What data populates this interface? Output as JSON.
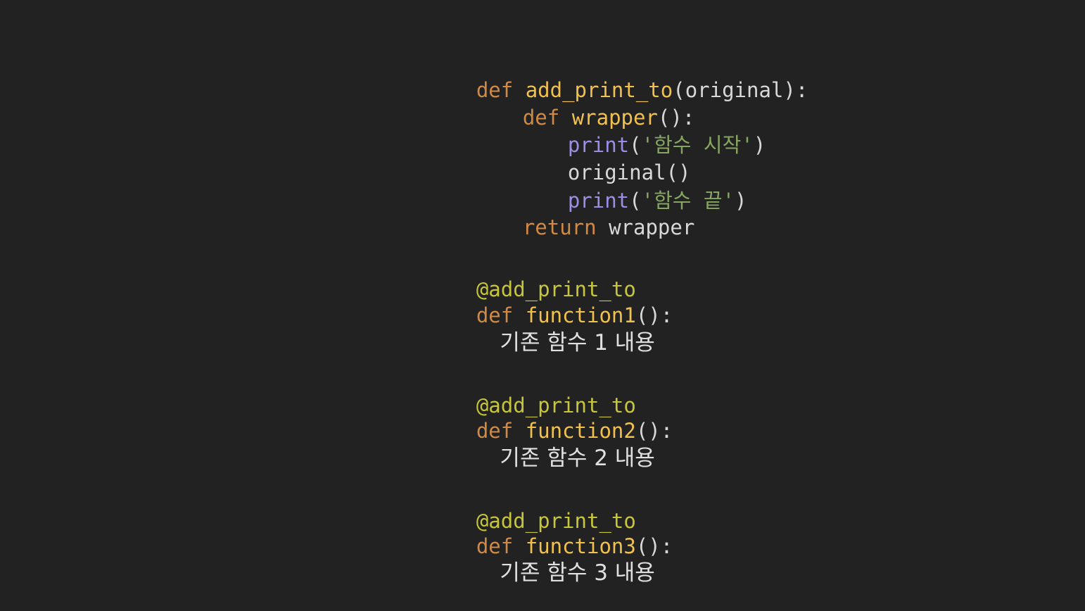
{
  "code": {
    "decorator_def": {
      "kw_def": "def",
      "name": "add_print_to",
      "open_paren": "(",
      "param": "original",
      "close": "):"
    },
    "wrapper_def": {
      "kw_def": "def",
      "name": "wrapper",
      "parens": "():"
    },
    "print_start": {
      "fn": "print",
      "open": "(",
      "str": "'함수 시작'",
      "close": ")"
    },
    "original_call": "original()",
    "print_end": {
      "fn": "print",
      "open": "(",
      "str": "'함수 끝'",
      "close": ")"
    },
    "return_line": {
      "kw_return": "return",
      "value": " wrapper"
    },
    "blocks": [
      {
        "decorator": "@add_print_to",
        "kw_def": "def",
        "name": "function1",
        "parens": "():",
        "body": "기존 함수 1 내용"
      },
      {
        "decorator": "@add_print_to",
        "kw_def": "def",
        "name": "function2",
        "parens": "():",
        "body": "기존 함수 2 내용"
      },
      {
        "decorator": "@add_print_to",
        "kw_def": "def",
        "name": "function3",
        "parens": "():",
        "body": "기존 함수 3 내용"
      }
    ]
  },
  "colors": {
    "background": "#222222",
    "keyword": "#d08a45",
    "function_name": "#f0c14e",
    "builtin": "#9c8ee6",
    "string": "#86a563",
    "decorator": "#c7c53a",
    "text": "#d8d8d8"
  }
}
